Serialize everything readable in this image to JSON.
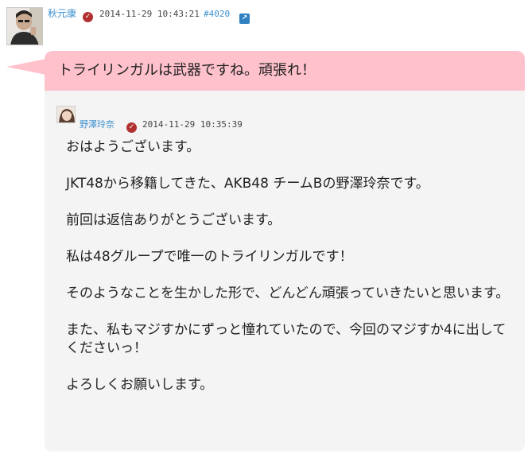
{
  "post": {
    "author": "秋元康",
    "timestamp": "2014-11-29 10:43:21",
    "number": "#4020",
    "message": "トライリンガルは武器ですね。頑張れ！"
  },
  "reply": {
    "author": "野澤玲奈",
    "timestamp": "2014-11-29 10:35:39",
    "paragraphs": [
      "おはようございます。",
      "JKT48から移籍してきた、AKB48 チームBの野澤玲奈です。",
      "前回は返信ありがとうございます。",
      "私は48グループで唯一のトライリンガルです！",
      "そのようなことを生かした形で、どんどん頑張っていきたいと思います。",
      "また、私もマジすかにずっと憧れていたので、今回のマジすか4に出してくださいっ！",
      "よろしくお願いします。"
    ]
  },
  "colors": {
    "bubble": "#ffc1cc",
    "card": "#f4f4f4",
    "link": "#3a8fcf",
    "badge": "#b23030"
  },
  "icons": [
    "verified-badge-icon",
    "external-link-icon"
  ]
}
